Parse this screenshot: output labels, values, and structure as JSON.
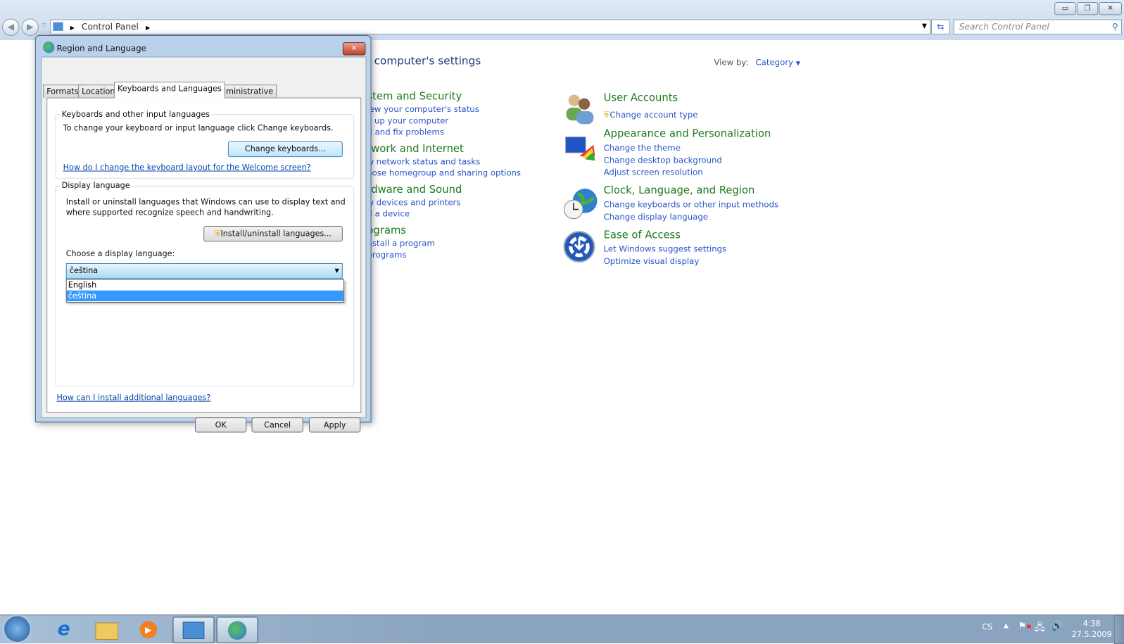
{
  "window": {
    "minimize": "▭",
    "maximize": "❐",
    "close": "✕"
  },
  "addressbar": {
    "crumbs": [
      "Control Panel"
    ],
    "search_placeholder": "Search Control Panel"
  },
  "control_panel": {
    "heading": "computer's settings",
    "view_by_label": "View by:",
    "view_by_value": "Category",
    "left_categories": [
      {
        "title": "stem and Security",
        "links": [
          "iew your computer's status",
          "k up your computer",
          "d and fix problems"
        ]
      },
      {
        "title": "twork and Internet",
        "links": [
          "w network status and tasks",
          "oose homegroup and sharing options"
        ]
      },
      {
        "title": "rdware and Sound",
        "links": [
          "w devices and printers",
          "d a device"
        ]
      },
      {
        "title": "ograms",
        "links": [
          "nstall a program",
          "programs"
        ]
      }
    ],
    "right_categories": [
      {
        "title": "User Accounts",
        "icon": "users-icon",
        "links": [
          "Change account type"
        ]
      },
      {
        "title": "Appearance and Personalization",
        "icon": "appearance-icon",
        "links": [
          "Change the theme",
          "Change desktop background",
          "Adjust screen resolution"
        ]
      },
      {
        "title": "Clock, Language, and Region",
        "icon": "clock-globe-icon",
        "links": [
          "Change keyboards or other input methods",
          "Change display language"
        ]
      },
      {
        "title": "Ease of Access",
        "icon": "ease-of-access-icon",
        "links": [
          "Let Windows suggest settings",
          "Optimize visual display"
        ]
      }
    ]
  },
  "dialog": {
    "title": "Region and Language",
    "tabs": [
      "Formats",
      "Location",
      "Keyboards and Languages",
      "Administrative"
    ],
    "active_tab": "Keyboards and Languages",
    "keyboards_group": {
      "label": "Keyboards and other input languages",
      "text": "To change your keyboard or input language click Change keyboards.",
      "button": "Change keyboards...",
      "link": "How do I change the keyboard layout for the Welcome screen?"
    },
    "display_group": {
      "label": "Display language",
      "text1": "Install or uninstall languages that Windows can use to display text and",
      "text2": "where supported recognize speech and handwriting.",
      "button": "Install/uninstall languages...",
      "choose_label": "Choose a display language:",
      "selected": "čeština",
      "options": [
        "English",
        "čeština"
      ]
    },
    "bottom_link": "How can I install additional languages?",
    "ok": "OK",
    "cancel": "Cancel",
    "apply": "Apply"
  },
  "taskbar": {
    "language": "CS",
    "time": "4:38",
    "date": "27.5.2009"
  },
  "colors": {
    "category_title": "#1e7a1e",
    "link": "#2a55c8",
    "selection": "#3399ff"
  }
}
